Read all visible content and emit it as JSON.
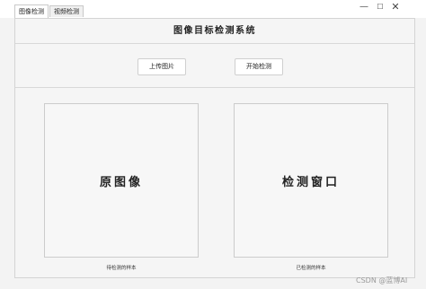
{
  "tabs": [
    {
      "label": "图像检测",
      "active": true
    },
    {
      "label": "视频检测",
      "active": false
    }
  ],
  "window_controls": {
    "minimize": "—",
    "maximize": "☐",
    "close": "✕"
  },
  "header": {
    "title": "图像目标检测系统"
  },
  "toolbar": {
    "upload_label": "上传图片",
    "start_label": "开始检测"
  },
  "views": {
    "original": {
      "placeholder": "原图像",
      "caption": "待检测的样本"
    },
    "result": {
      "placeholder": "检测窗口",
      "caption": "已检测的样本"
    }
  },
  "watermark": "CSDN @蓝博AI"
}
